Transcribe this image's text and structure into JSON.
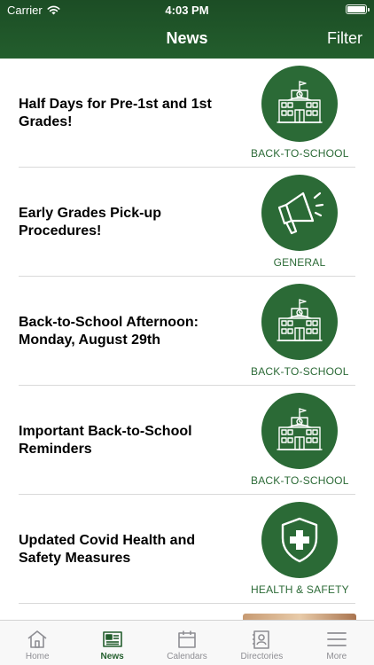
{
  "status_bar": {
    "carrier": "Carrier",
    "time": "4:03 PM"
  },
  "nav": {
    "title": "News",
    "filter_label": "Filter"
  },
  "news": [
    {
      "title": "Half Days for Pre-1st and 1st Grades!",
      "category": "BACK-TO-SCHOOL",
      "icon": "school-icon"
    },
    {
      "title": "Early Grades Pick-up Procedures!",
      "category": "GENERAL",
      "icon": "megaphone-icon"
    },
    {
      "title": "Back-to-School Afternoon: Monday, August 29th",
      "category": "BACK-TO-SCHOOL",
      "icon": "school-icon"
    },
    {
      "title": "Important Back-to-School Reminders",
      "category": "BACK-TO-SCHOOL",
      "icon": "school-icon"
    },
    {
      "title": "Updated Covid Health and Safety Measures",
      "category": "HEALTH & SAFETY",
      "icon": "shield-cross-icon"
    }
  ],
  "tabs": [
    {
      "label": "Home",
      "icon": "home-icon"
    },
    {
      "label": "News",
      "icon": "newspaper-icon",
      "active": true
    },
    {
      "label": "Calendars",
      "icon": "calendar-icon"
    },
    {
      "label": "Directories",
      "icon": "contact-card-icon"
    },
    {
      "label": "More",
      "icon": "menu-icon"
    }
  ],
  "colors": {
    "brand_green": "#235e2d",
    "badge_green": "#2b6a36",
    "tab_inactive": "#8e8e93"
  }
}
